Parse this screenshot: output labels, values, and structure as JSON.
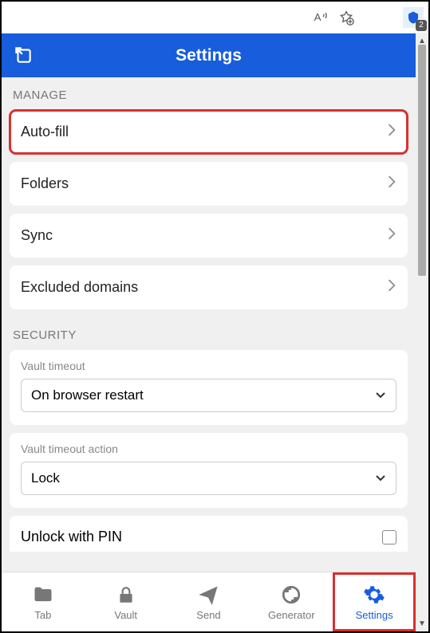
{
  "browser": {
    "ext_badge": "2"
  },
  "header": {
    "title": "Settings"
  },
  "sections": {
    "manage": {
      "label": "MANAGE",
      "items": [
        "Auto-fill",
        "Folders",
        "Sync",
        "Excluded domains"
      ]
    },
    "security": {
      "label": "SECURITY",
      "vault_timeout_label": "Vault timeout",
      "vault_timeout_value": "On browser restart",
      "vault_timeout_action_label": "Vault timeout action",
      "vault_timeout_action_value": "Lock",
      "unlock_with_pin_label": "Unlock with PIN"
    }
  },
  "bottom_nav": {
    "items": [
      "Tab",
      "Vault",
      "Send",
      "Generator",
      "Settings"
    ]
  }
}
